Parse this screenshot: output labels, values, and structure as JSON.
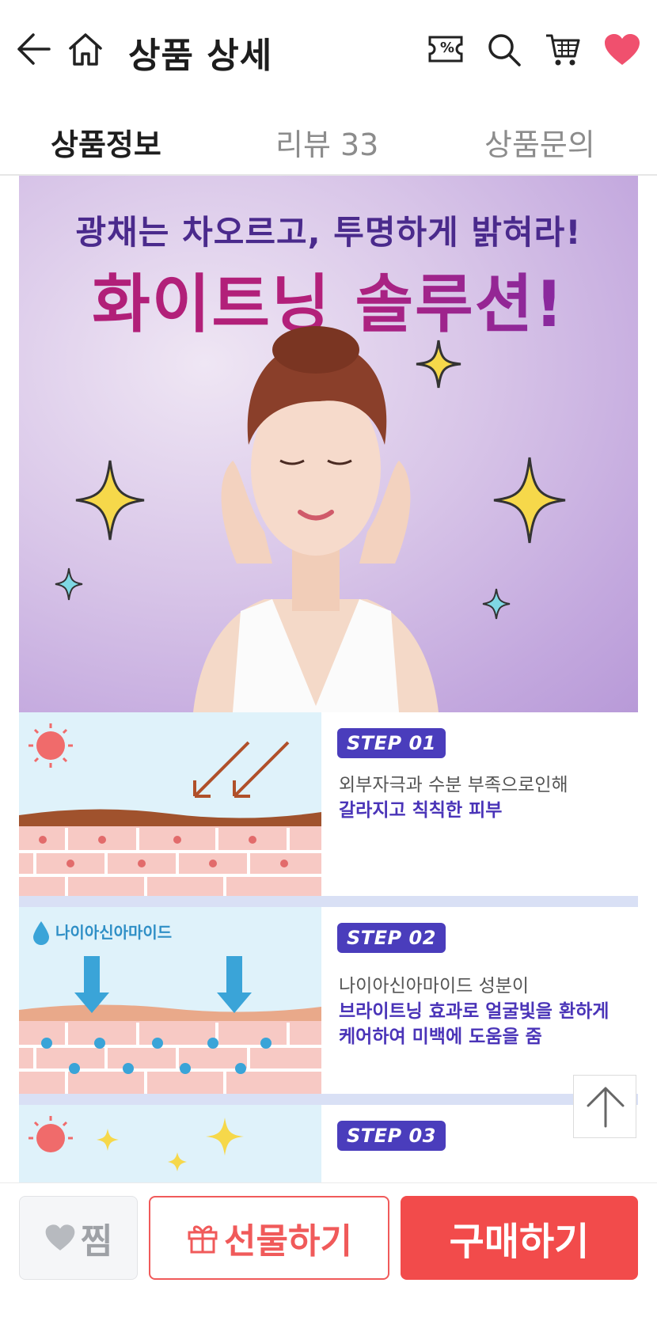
{
  "header": {
    "title": "상품 상세",
    "icons": [
      "back-arrow-icon",
      "home-icon",
      "coupon-icon",
      "search-icon",
      "cart-icon",
      "heart-icon"
    ],
    "coupon_symbol": "%"
  },
  "tabs": [
    {
      "label": "상품정보",
      "active": true
    },
    {
      "label": "리뷰 33",
      "active": false
    },
    {
      "label": "상품문의",
      "active": false
    }
  ],
  "hero": {
    "subtitle": "광채는 차오르고, 투명하게 밝혀라!",
    "title": "화이트닝 솔루션!"
  },
  "steps": [
    {
      "badge": "STEP 01",
      "line1": "외부자극과 수분 부족으로인해",
      "line2": "갈라지고 칙칙한 피부",
      "line3": ""
    },
    {
      "badge": "STEP 02",
      "ingredient": "나이아신아마이드",
      "line1": "나이아신아마이드 성분이",
      "line2": "브라이트닝 효과로 얼굴빛을 환하게",
      "line3": "케어하여 미백에 도움을 줌"
    },
    {
      "badge": "STEP 03",
      "line1": "",
      "line2": "",
      "line3": ""
    }
  ],
  "bottom": {
    "wish_label": "찜",
    "gift_label": "선물하기",
    "buy_label": "구매하기"
  },
  "colors": {
    "accent": "#f24b4b",
    "heart": "#f0506e",
    "step_badge": "#4a3dbc",
    "hero_title": "#b3207a"
  }
}
